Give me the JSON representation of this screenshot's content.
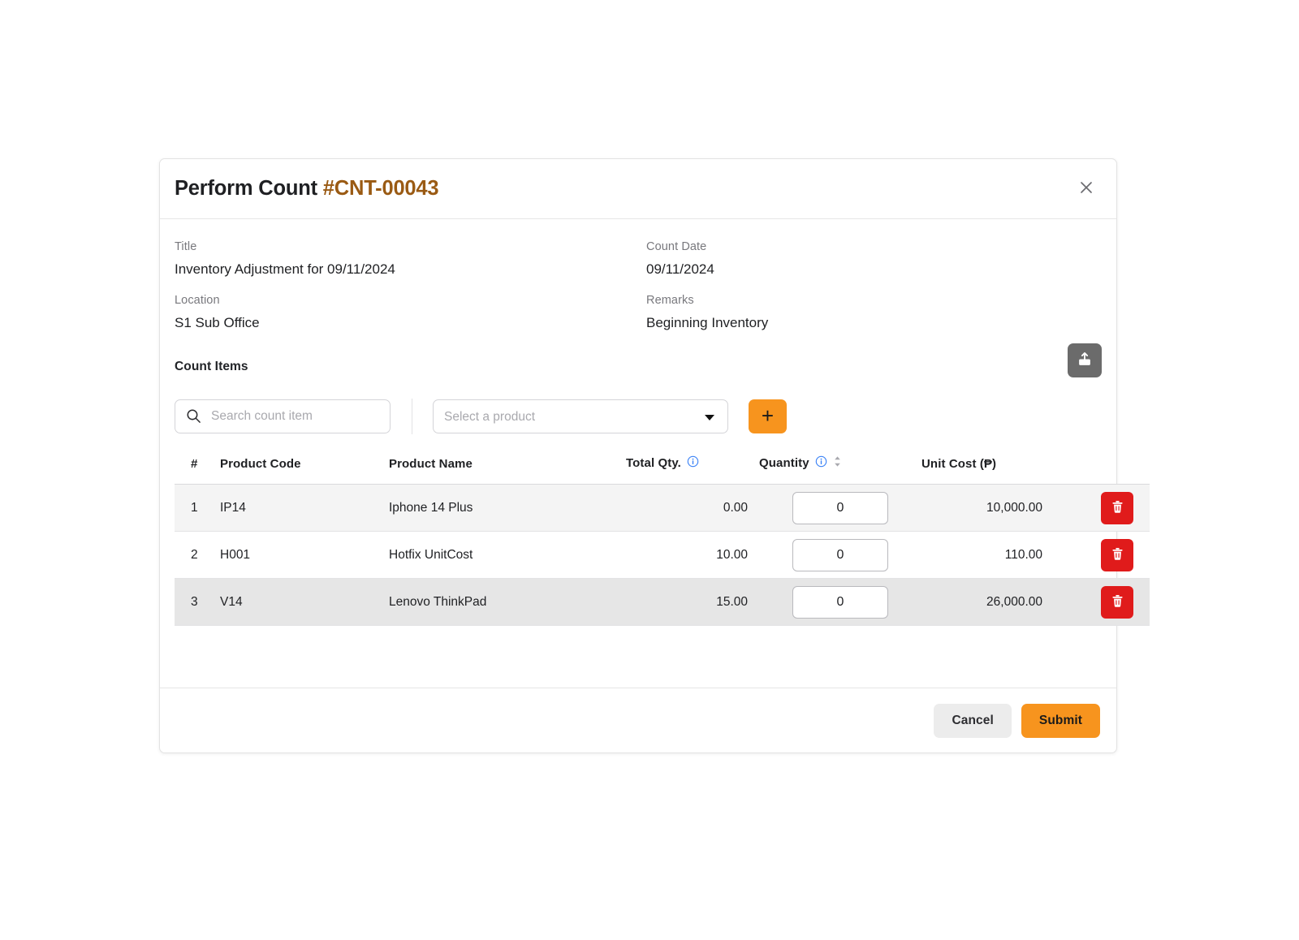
{
  "modal": {
    "title_prefix": "Perform Count ",
    "title_ref": "#CNT-00043",
    "close_icon": "close-icon"
  },
  "details": {
    "title_label": "Title",
    "title_value": "Inventory Adjustment for 09/11/2024",
    "count_date_label": "Count Date",
    "count_date_value": "09/11/2024",
    "location_label": "Location",
    "location_value": "S1 Sub Office",
    "remarks_label": "Remarks",
    "remarks_value": "Beginning Inventory"
  },
  "count_items": {
    "section_title": "Count Items",
    "upload_icon": "upload-icon",
    "search_placeholder": "Search count item",
    "search_value": "",
    "search_icon": "search-icon",
    "product_select_placeholder": "Select a product",
    "product_select_value": "",
    "product_select_options": [
      "Select a product"
    ],
    "caret_icon": "chevron-down-icon",
    "add_label": "+",
    "columns": {
      "num": "#",
      "product_code": "Product Code",
      "product_name": "Product Name",
      "total_qty": "Total Qty.",
      "quantity": "Quantity",
      "unit_cost": "Unit Cost (₱)"
    },
    "rows": [
      {
        "num": "1",
        "code": "IP14",
        "name": "Iphone 14 Plus",
        "total_qty": "0.00",
        "quantity": "0",
        "unit_cost": "10,000.00"
      },
      {
        "num": "2",
        "code": "H001",
        "name": "Hotfix UnitCost",
        "total_qty": "10.00",
        "quantity": "0",
        "unit_cost": "110.00"
      },
      {
        "num": "3",
        "code": "V14",
        "name": "Lenovo ThinkPad",
        "total_qty": "15.00",
        "quantity": "0",
        "unit_cost": "26,000.00"
      }
    ],
    "delete_icon": "trash-icon",
    "info_icon": "info-icon",
    "sort_icon": "sort-icon"
  },
  "footer": {
    "cancel_label": "Cancel",
    "submit_label": "Submit"
  },
  "colors": {
    "accent_orange": "#f7941e",
    "title_accent": "#9a5a13",
    "danger_red": "#e01b1b",
    "upload_gray": "#6b6b6b",
    "info_blue": "#3b82f6"
  }
}
